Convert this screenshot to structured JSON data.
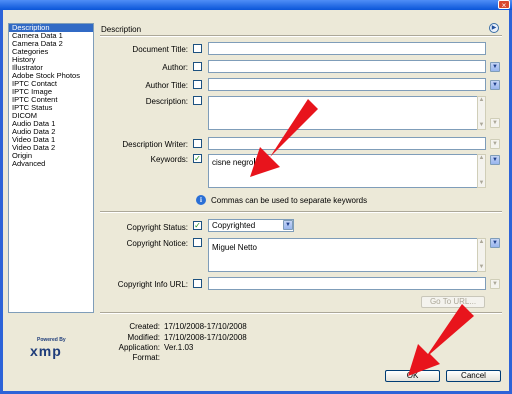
{
  "sidebar": {
    "items": [
      "Description",
      "Camera Data 1",
      "Camera Data 2",
      "Categories",
      "History",
      "Illustrator",
      "Adobe Stock Photos",
      "IPTC Contact",
      "IPTC Image",
      "IPTC Content",
      "IPTC Status",
      "DICOM",
      "Audio Data 1",
      "Audio Data 2",
      "Video Data 1",
      "Video Data 2",
      "Origin",
      "Advanced"
    ],
    "selected_index": 0
  },
  "section_title": "Description",
  "fields": {
    "document_title": {
      "label": "Document Title:",
      "value": ""
    },
    "author": {
      "label": "Author:",
      "value": ""
    },
    "author_title": {
      "label": "Author Title:",
      "value": ""
    },
    "description": {
      "label": "Description:",
      "value": ""
    },
    "description_writer": {
      "label": "Description Writer:",
      "value": ""
    },
    "keywords": {
      "label": "Keywords:",
      "value": "cisne negro",
      "checked": true
    },
    "keywords_hint": "Commas can be used to separate keywords",
    "copyright_status": {
      "label": "Copyright Status:",
      "value": "Copyrighted",
      "checked": true
    },
    "copyright_notice": {
      "label": "Copyright Notice:",
      "value": "Miguel Netto"
    },
    "copyright_info_url": {
      "label": "Copyright Info URL:",
      "value": ""
    }
  },
  "go_to_url_label": "Go To URL...",
  "metadata": {
    "created_label": "Created:",
    "created_value": "17/10/2008-17/10/2008",
    "modified_label": "Modified:",
    "modified_value": "17/10/2008-17/10/2008",
    "application_label": "Application:",
    "application_value": "Ver.1.03",
    "format_label": "Format:",
    "format_value": ""
  },
  "logo": {
    "powered_by": "Powered By",
    "brand": "xmp"
  },
  "buttons": {
    "ok": "OK",
    "cancel": "Cancel"
  },
  "icons": {
    "window_close": "×",
    "expand": "▶",
    "dropdown": "▼",
    "info": "i",
    "check": "✓",
    "scroll_up": "▲",
    "scroll_down": "▼"
  },
  "colors": {
    "accent": "#316ac5",
    "annotation_arrow": "#e8141c"
  }
}
